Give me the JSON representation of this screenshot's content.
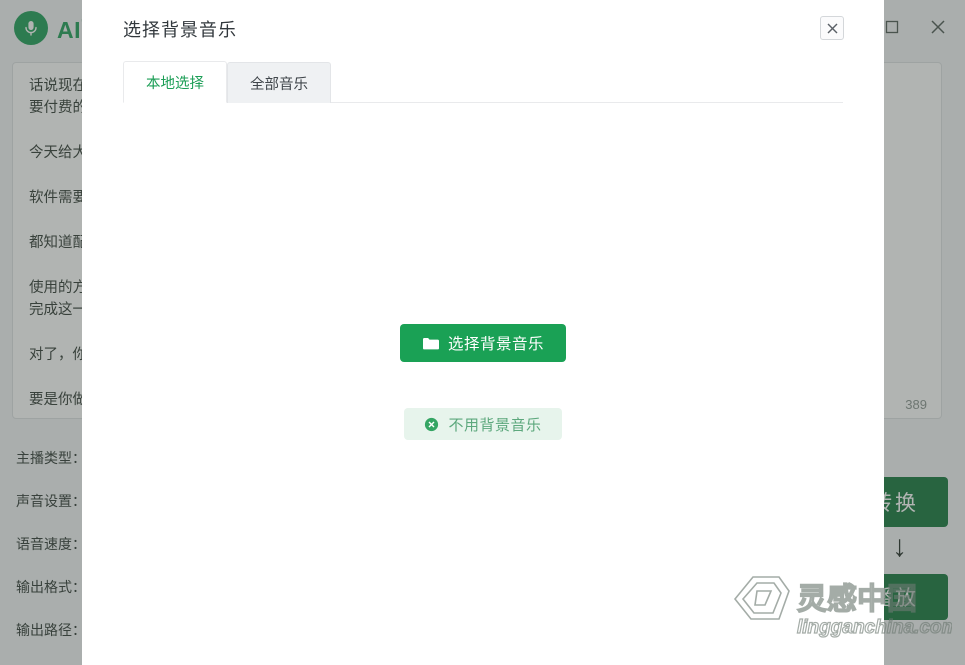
{
  "app": {
    "title": "AI配音",
    "logo_icon": "microphone-icon",
    "window_controls": [
      {
        "name": "maximize-button",
        "icon": "maximize-icon"
      },
      {
        "name": "close-button",
        "icon": "close-icon"
      }
    ],
    "script_lines": [
      "话说现在是部是需",
      "要付费的，",
      "今天给大家",
      "软件需要安",
      "都知道配音",
      "使用的方法",
      "完成这一步",
      "对了，你要",
      "要是你做知"
    ],
    "char_count": "389",
    "settings": [
      {
        "label": "主播类型："
      },
      {
        "label": "声音设置："
      },
      {
        "label": "语音速度："
      },
      {
        "label": "输出格式："
      },
      {
        "label": "输出路径："
      }
    ],
    "convert_label": "转换",
    "play_label": "播放",
    "arrow_icon": "arrow-down-icon"
  },
  "modal": {
    "title": "选择背景音乐",
    "close_icon": "close-icon",
    "tabs": [
      {
        "label": "本地选择",
        "active": true
      },
      {
        "label": "全部音乐",
        "active": false
      }
    ],
    "primary_action": {
      "label": "选择背景音乐",
      "icon": "folder-icon"
    },
    "secondary_action": {
      "label": "不用背景音乐",
      "icon": "circle-x-icon"
    }
  },
  "watermark": {
    "text": "灵感中国",
    "subtext": "lingganchina.com"
  },
  "colors": {
    "brand_green": "#1c9e56",
    "button_green": "#1aa155",
    "dark_green": "#14753c",
    "soft_green_bg": "#e7f4ec",
    "soft_green_text": "#5da87d"
  }
}
